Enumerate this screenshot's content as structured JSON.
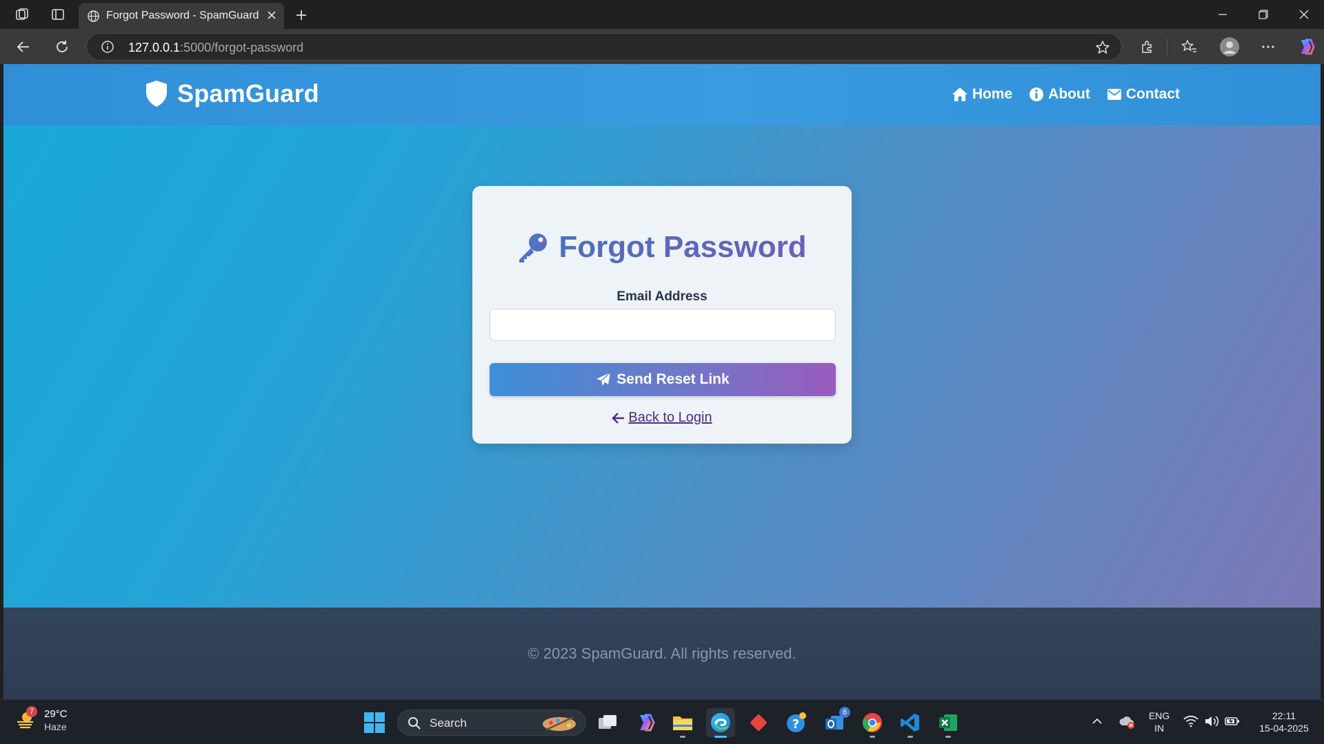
{
  "browser": {
    "tab_title": "Forgot Password - SpamGuard",
    "url_host": "127.0.0.1",
    "url_path": ":5000/forgot-password"
  },
  "site": {
    "brand": "SpamGuard",
    "nav": [
      {
        "label": "Home",
        "icon": "home-icon"
      },
      {
        "label": "About",
        "icon": "info-icon"
      },
      {
        "label": "Contact",
        "icon": "envelope-icon"
      }
    ]
  },
  "form": {
    "title": "Forgot Password",
    "title_icon": "key-icon",
    "email_label": "Email Address",
    "email_value": "",
    "submit_label": "Send Reset Link",
    "back_label": "Back to Login"
  },
  "footer": {
    "text": "© 2023 SpamGuard. All rights reserved."
  },
  "taskbar": {
    "weather_temp": "29°C",
    "weather_desc": "Haze",
    "weather_badge": "7",
    "search_label": "Search",
    "outlook_badge": "6",
    "language_top": "ENG",
    "language_bottom": "IN",
    "time": "22:11",
    "date": "15-04-2025"
  },
  "colors": {
    "header": "#3498db",
    "card_bg": "#eef3f8",
    "title_gradient_start": "#4b6fc0",
    "title_gradient_end": "#6d5fb8",
    "button_gradient_start": "#3d8fd6",
    "button_gradient_end": "#9a5bbf",
    "footer_bg": "#2e3d54"
  }
}
